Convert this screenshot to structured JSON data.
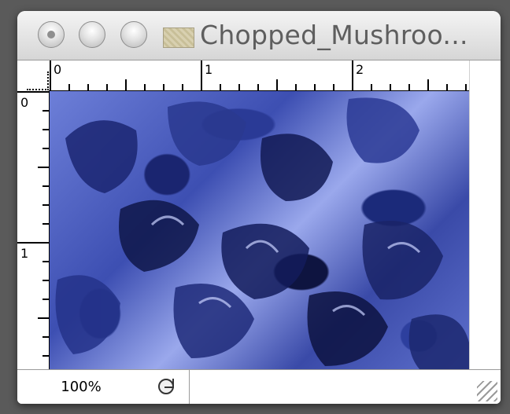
{
  "window": {
    "title": "Chopped_Mushroo...",
    "title_color": "#5e5e5e",
    "buttons": [
      "close-button",
      "minimize-button",
      "zoom-button"
    ]
  },
  "rulers": {
    "horizontal_labels": [
      "0",
      "1",
      "2"
    ],
    "vertical_labels": [
      "0",
      "1"
    ]
  },
  "canvas": {
    "description_icon": "image-icon",
    "dominant_color": "#3d4fb2"
  },
  "status_bar": {
    "zoom": "100%",
    "nav_icon": "navigator-icon"
  }
}
